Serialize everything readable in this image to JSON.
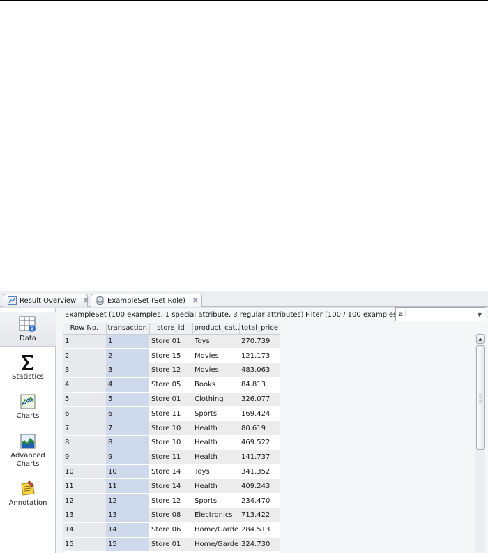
{
  "tabs": [
    {
      "label": "Result Overview",
      "icon": "result-overview-icon",
      "close": "✖"
    },
    {
      "label": "ExampleSet (Set Role)",
      "icon": "exampleset-icon",
      "close": "✖"
    }
  ],
  "sidebar": {
    "items": [
      {
        "label": "Data",
        "icon": "data-table-icon"
      },
      {
        "label": "Statistics",
        "icon": "sigma-icon"
      },
      {
        "label": "Charts",
        "icon": "chart-icon"
      },
      {
        "label": "Advanced Charts",
        "label_line1": "Advanced",
        "label_line2": "Charts",
        "icon": "advanced-chart-icon"
      },
      {
        "label": "Annotation",
        "icon": "annotation-note-icon"
      }
    ]
  },
  "main": {
    "summary": "ExampleSet (100 examples, 1 special attribute, 3 regular attributes)",
    "filter_label": "Filter (100 / 100 examples):",
    "filter_value": "all",
    "columns": [
      "Row No.",
      "transaction...",
      "store_id",
      "product_cat...",
      "total_price"
    ],
    "rows": [
      [
        "1",
        "1",
        "Store 01",
        "Toys",
        "270.739"
      ],
      [
        "2",
        "2",
        "Store 15",
        "Movies",
        "121.173"
      ],
      [
        "3",
        "3",
        "Store 12",
        "Movies",
        "483.063"
      ],
      [
        "4",
        "4",
        "Store 05",
        "Books",
        "84.813"
      ],
      [
        "5",
        "5",
        "Store 01",
        "Clothing",
        "326.077"
      ],
      [
        "6",
        "6",
        "Store 11",
        "Sports",
        "169.424"
      ],
      [
        "7",
        "7",
        "Store 10",
        "Health",
        "80.619"
      ],
      [
        "8",
        "8",
        "Store 10",
        "Health",
        "469.522"
      ],
      [
        "9",
        "9",
        "Store 11",
        "Health",
        "141.737"
      ],
      [
        "10",
        "10",
        "Store 14",
        "Toys",
        "341.352"
      ],
      [
        "11",
        "11",
        "Store 14",
        "Health",
        "409.243"
      ],
      [
        "12",
        "12",
        "Store 12",
        "Sports",
        "234.470"
      ],
      [
        "13",
        "13",
        "Store 08",
        "Electronics",
        "713.422"
      ],
      [
        "14",
        "14",
        "Store 06",
        "Home/Garde",
        "284.513"
      ],
      [
        "15",
        "15",
        "Store 01",
        "Home/Garde",
        "324.730"
      ]
    ]
  }
}
